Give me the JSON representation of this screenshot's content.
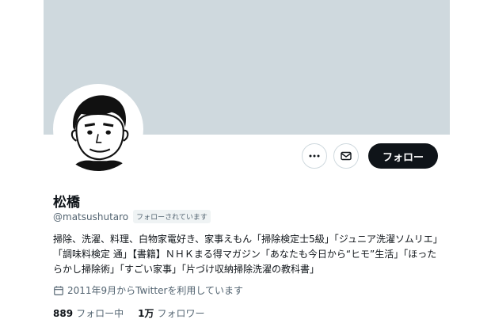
{
  "profile": {
    "name": "松橋",
    "handle": "@matsushutaro",
    "follows_you": "フォローされています",
    "bio": "掃除、洗濯、料理、白物家電好き、家事えもん「掃除検定士5級」「ジュニア洗濯ソムリエ」「調味料検定 通」【書籍】ＮＨＫまる得マガジン「あなたも今日から“ヒモ”生活」「ほったらかし掃除術」「すごい家事」「片づけ収納掃除洗濯の教科書」",
    "joined": "2011年9月からTwitterを利用しています"
  },
  "actions": {
    "more_icon": "more-icon",
    "message_icon": "mail-icon",
    "follow_label": "フォロー"
  },
  "stats": {
    "following_count": "889",
    "following_label": "フォロー中",
    "followers_count": "1万",
    "followers_label": "フォロワー"
  },
  "colors": {
    "banner": "#cfd9de",
    "primary_text": "#0f1419",
    "secondary_text": "#536471",
    "follow_button": "#0f1419"
  }
}
